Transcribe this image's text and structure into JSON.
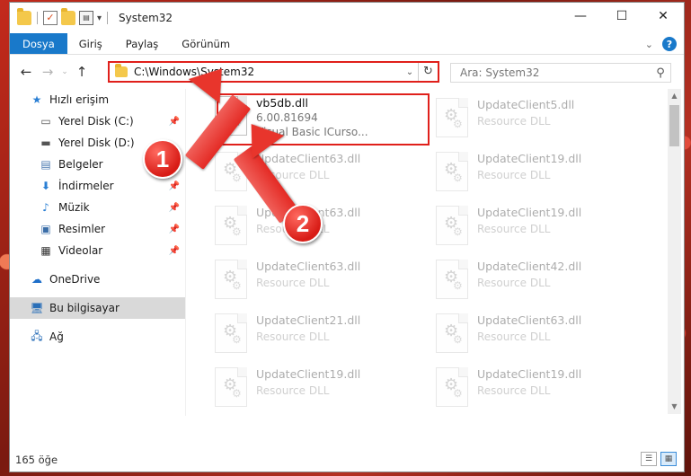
{
  "window": {
    "title": "System32",
    "controls": {
      "minimize": "—",
      "maximize": "☐",
      "close": "✕"
    }
  },
  "ribbon": {
    "tabs": [
      "Dosya",
      "Giriş",
      "Paylaş",
      "Görünüm"
    ],
    "help": "?"
  },
  "address": {
    "path": "C:\\Windows\\System32",
    "refresh": "↻"
  },
  "search": {
    "placeholder": "Ara: System32"
  },
  "sidebar": {
    "items": [
      {
        "label": "Hızlı erişim",
        "icon": "star-icon",
        "pinned": false
      },
      {
        "label": "Yerel Disk (C:)",
        "icon": "drive-icon",
        "pinned": true
      },
      {
        "label": "Yerel Disk (D:)",
        "icon": "drive-icon",
        "pinned": false
      },
      {
        "label": "Belgeler",
        "icon": "documents-icon",
        "pinned": true
      },
      {
        "label": "İndirmeler",
        "icon": "download-icon",
        "pinned": true
      },
      {
        "label": "Müzik",
        "icon": "music-icon",
        "pinned": true
      },
      {
        "label": "Resimler",
        "icon": "pictures-icon",
        "pinned": true
      },
      {
        "label": "Videolar",
        "icon": "video-icon",
        "pinned": true
      },
      {
        "label": "OneDrive",
        "icon": "cloud-icon",
        "pinned": false
      },
      {
        "label": "Bu bilgisayar",
        "icon": "computer-icon",
        "pinned": false
      },
      {
        "label": "Ağ",
        "icon": "network-icon",
        "pinned": false
      }
    ]
  },
  "files": {
    "highlighted": {
      "name": "vb5db.dll",
      "version": "6.00.81694",
      "desc": "Visual Basic ICurso..."
    },
    "left_column": [
      {
        "name": "UpdateClient63.dll",
        "type": "Resource DLL"
      },
      {
        "name": "UpdateClient63.dll",
        "type": "Resource DLL"
      },
      {
        "name": "UpdateClient63.dll",
        "type": "Resource DLL"
      },
      {
        "name": "UpdateClient21.dll",
        "type": "Resource DLL"
      },
      {
        "name": "UpdateClient19.dll",
        "type": "Resource DLL"
      }
    ],
    "right_column": [
      {
        "name": "UpdateClient5.dll",
        "type": "Resource DLL"
      },
      {
        "name": "UpdateClient19.dll",
        "type": "Resource DLL"
      },
      {
        "name": "UpdateClient19.dll",
        "type": "Resource DLL"
      },
      {
        "name": "UpdateClient42.dll",
        "type": "Resource DLL"
      },
      {
        "name": "UpdateClient63.dll",
        "type": "Resource DLL"
      },
      {
        "name": "UpdateClient19.dll",
        "type": "Resource DLL"
      }
    ]
  },
  "status": {
    "count": "165 öğe"
  },
  "annotations": {
    "step1": "1",
    "step2": "2"
  },
  "colors": {
    "accent": "#1979ca",
    "highlight_red": "#e0201b"
  }
}
